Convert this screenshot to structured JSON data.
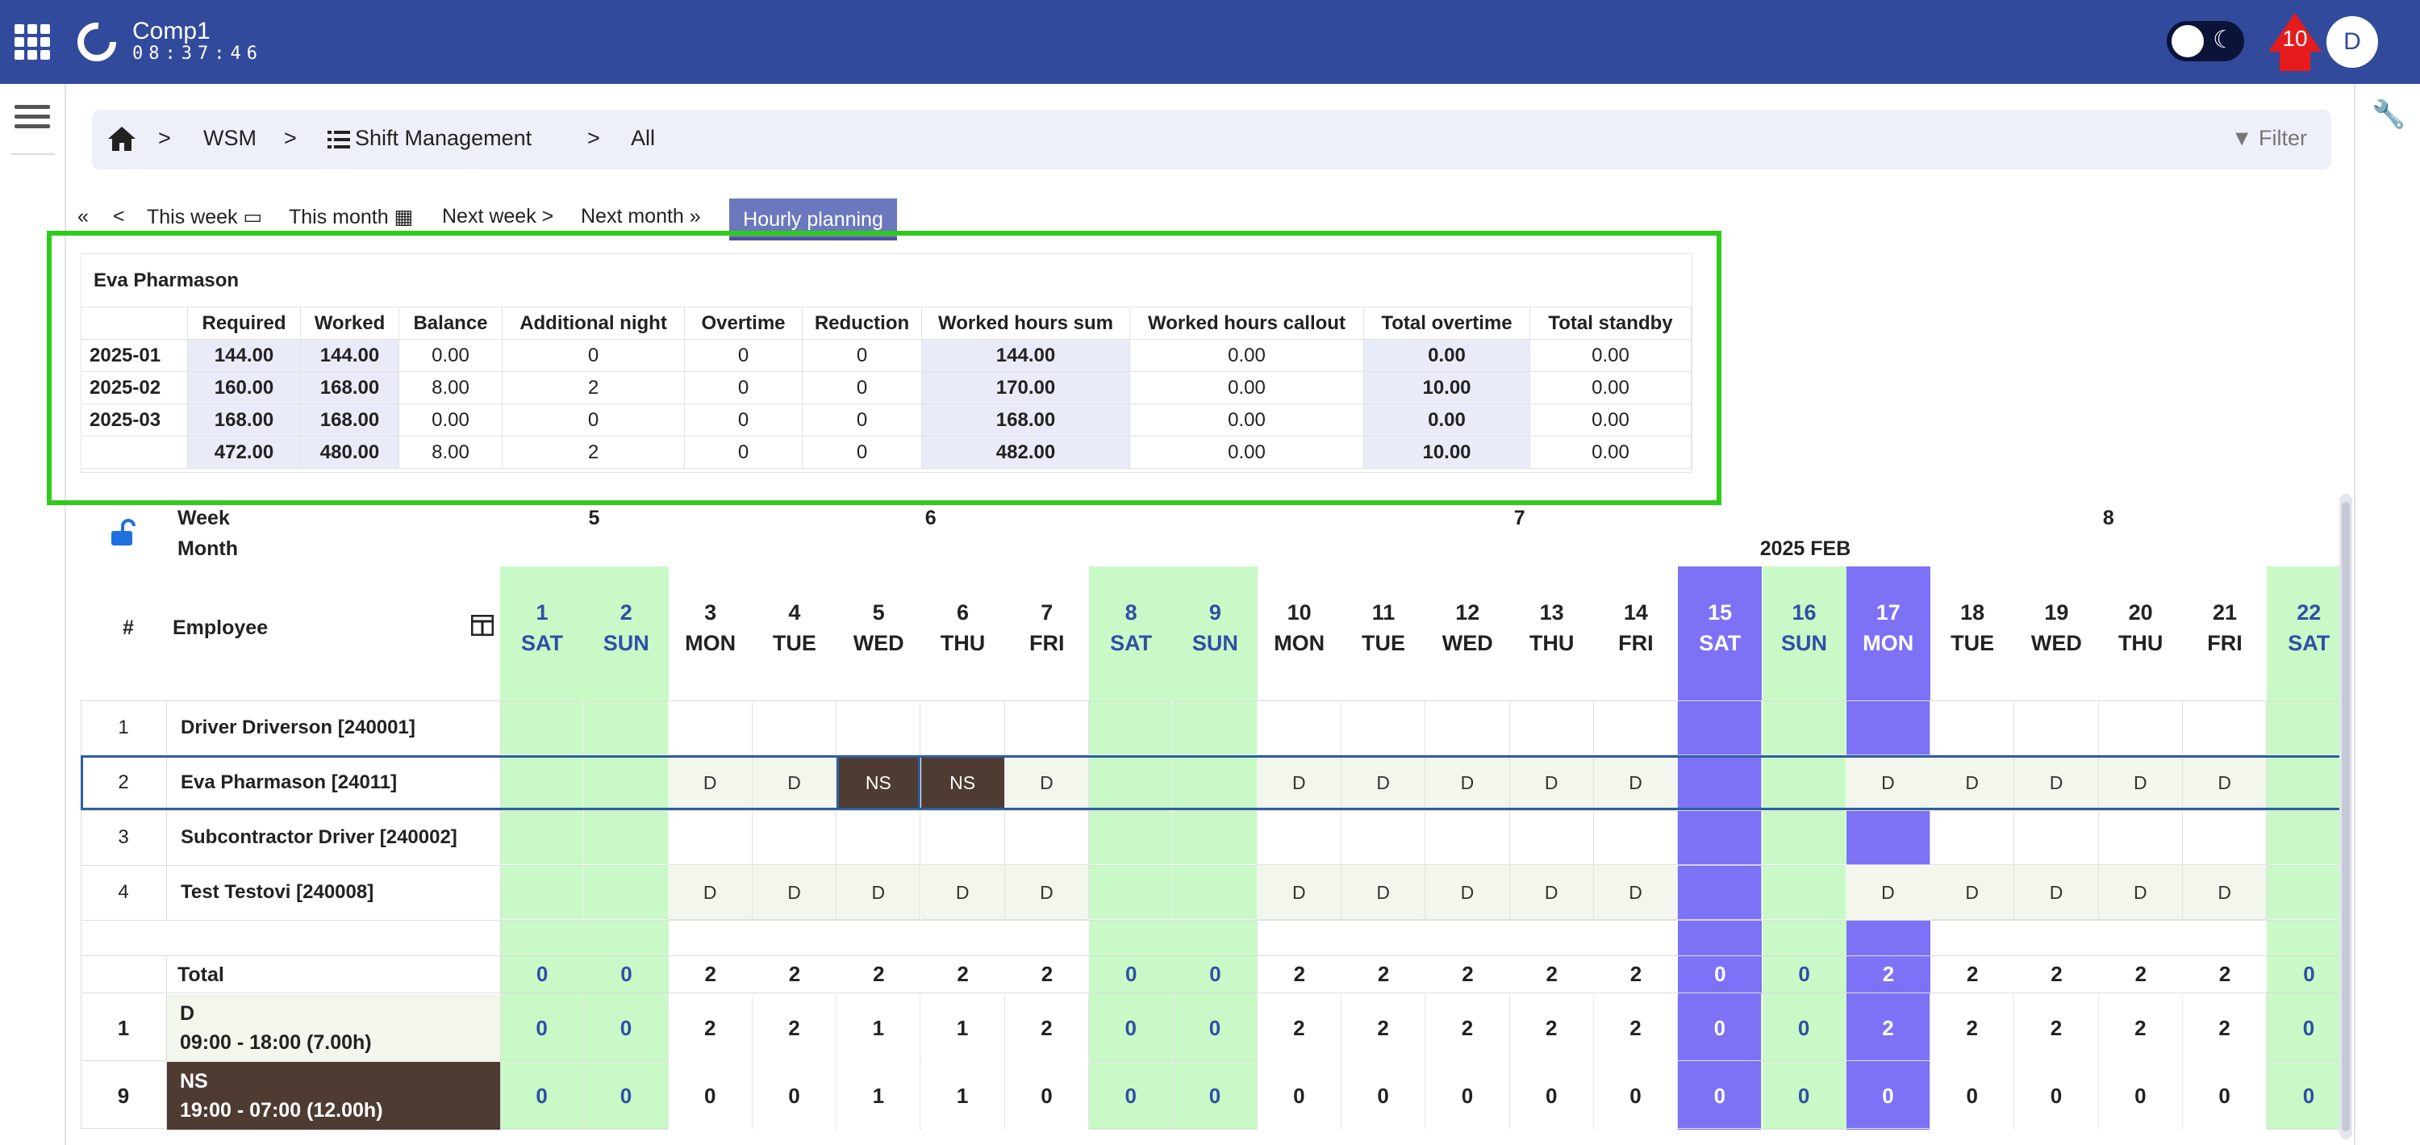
{
  "app": {
    "company": "Comp1",
    "clock": "08:37:46",
    "notifications": "10",
    "avatar": "D"
  },
  "breadcrumb": {
    "items": [
      "WSM",
      "Shift Management",
      "All"
    ],
    "filter_label": "Filter"
  },
  "nav": {
    "this_week": "This week",
    "this_month": "This month",
    "next_week": "Next week",
    "next_month": "Next month",
    "hourly_planning": "Hourly planning"
  },
  "summary": {
    "employee": "Eva Pharmason",
    "columns": [
      "Required",
      "Worked",
      "Balance",
      "Additional night",
      "Overtime",
      "Reduction",
      "Worked hours sum",
      "Worked hours callout",
      "Total overtime",
      "Total standby"
    ],
    "rows": [
      {
        "period": "2025-01",
        "values": [
          "144.00",
          "144.00",
          "0.00",
          "0",
          "0",
          "0",
          "144.00",
          "0.00",
          "0.00",
          "0.00"
        ]
      },
      {
        "period": "2025-02",
        "values": [
          "160.00",
          "168.00",
          "8.00",
          "2",
          "0",
          "0",
          "170.00",
          "0.00",
          "10.00",
          "0.00"
        ]
      },
      {
        "period": "2025-03",
        "values": [
          "168.00",
          "168.00",
          "0.00",
          "0",
          "0",
          "0",
          "168.00",
          "0.00",
          "0.00",
          "0.00"
        ]
      },
      {
        "period": "",
        "values": [
          "472.00",
          "480.00",
          "8.00",
          "2",
          "0",
          "0",
          "482.00",
          "0.00",
          "10.00",
          "0.00"
        ]
      }
    ]
  },
  "schedule": {
    "week_label": "Week",
    "month_label": "Month",
    "month": "2025 FEB",
    "index_label": "#",
    "employee_label": "Employee",
    "weeks": [
      {
        "label": "5",
        "day_index": 1
      },
      {
        "label": "6",
        "day_index": 5
      },
      {
        "label": "7",
        "day_index": 12
      },
      {
        "label": "8",
        "day_index": 19
      }
    ],
    "days": [
      {
        "num": "1",
        "dow": "SAT",
        "type": "weekend"
      },
      {
        "num": "2",
        "dow": "SUN",
        "type": "weekend"
      },
      {
        "num": "3",
        "dow": "MON",
        "type": "work"
      },
      {
        "num": "4",
        "dow": "TUE",
        "type": "work"
      },
      {
        "num": "5",
        "dow": "WED",
        "type": "work"
      },
      {
        "num": "6",
        "dow": "THU",
        "type": "work"
      },
      {
        "num": "7",
        "dow": "FRI",
        "type": "work"
      },
      {
        "num": "8",
        "dow": "SAT",
        "type": "weekend"
      },
      {
        "num": "9",
        "dow": "SUN",
        "type": "weekend"
      },
      {
        "num": "10",
        "dow": "MON",
        "type": "work"
      },
      {
        "num": "11",
        "dow": "TUE",
        "type": "work"
      },
      {
        "num": "12",
        "dow": "WED",
        "type": "work"
      },
      {
        "num": "13",
        "dow": "THU",
        "type": "work"
      },
      {
        "num": "14",
        "dow": "FRI",
        "type": "work"
      },
      {
        "num": "15",
        "dow": "SAT",
        "type": "holiday"
      },
      {
        "num": "16",
        "dow": "SUN",
        "type": "weekend"
      },
      {
        "num": "17",
        "dow": "MON",
        "type": "holiday"
      },
      {
        "num": "18",
        "dow": "TUE",
        "type": "work"
      },
      {
        "num": "19",
        "dow": "WED",
        "type": "work"
      },
      {
        "num": "20",
        "dow": "THU",
        "type": "work"
      },
      {
        "num": "21",
        "dow": "FRI",
        "type": "work"
      },
      {
        "num": "22",
        "dow": "SAT",
        "type": "weekend"
      }
    ],
    "employees": [
      {
        "idx": "1",
        "name": "Driver Driverson [240001]",
        "shifts": [
          "",
          "",
          "",
          "",
          "",
          "",
          "",
          "",
          "",
          "",
          "",
          "",
          "",
          "",
          "",
          "",
          "",
          "",
          "",
          "",
          "",
          ""
        ]
      },
      {
        "idx": "2",
        "name": "Eva Pharmason [24011]",
        "shifts": [
          "",
          "",
          "D",
          "D",
          "NS",
          "NS",
          "D",
          "",
          "",
          "D",
          "D",
          "D",
          "D",
          "D",
          "",
          "",
          "D",
          "D",
          "D",
          "D",
          "D",
          ""
        ]
      },
      {
        "idx": "3",
        "name": "Subcontractor Driver [240002]",
        "shifts": [
          "",
          "",
          "",
          "",
          "",
          "",
          "",
          "",
          "",
          "",
          "",
          "",
          "",
          "",
          "",
          "",
          "",
          "",
          "",
          "",
          "",
          ""
        ]
      },
      {
        "idx": "4",
        "name": "Test Testovi [240008]",
        "shifts": [
          "",
          "",
          "D",
          "D",
          "D",
          "D",
          "D",
          "",
          "",
          "D",
          "D",
          "D",
          "D",
          "D",
          "",
          "",
          "D",
          "D",
          "D",
          "D",
          "D",
          ""
        ]
      }
    ],
    "totals": {
      "label": "Total",
      "values": [
        "0",
        "0",
        "2",
        "2",
        "2",
        "2",
        "2",
        "0",
        "0",
        "2",
        "2",
        "2",
        "2",
        "2",
        "0",
        "0",
        "2",
        "2",
        "2",
        "2",
        "2",
        "0"
      ]
    },
    "shift_types": [
      {
        "count": "1",
        "code": "D",
        "time": "09:00 - 18:00 (7.00h)",
        "values": [
          "0",
          "0",
          "2",
          "2",
          "1",
          "1",
          "2",
          "0",
          "0",
          "2",
          "2",
          "2",
          "2",
          "2",
          "0",
          "0",
          "2",
          "2",
          "2",
          "2",
          "2",
          "0"
        ]
      },
      {
        "count": "9",
        "code": "NS",
        "time": "19:00 - 07:00 (12.00h)",
        "values": [
          "0",
          "0",
          "0",
          "0",
          "1",
          "1",
          "0",
          "0",
          "0",
          "0",
          "0",
          "0",
          "0",
          "0",
          "0",
          "0",
          "0",
          "0",
          "0",
          "0",
          "0",
          "0"
        ]
      }
    ],
    "colors": {
      "weekend": "#c9f9c6",
      "holiday": "#7d72f5",
      "night_shift": "#4e3b32",
      "day_shift": "#f2f6ec",
      "selected_row": "#2d5fa0"
    }
  }
}
